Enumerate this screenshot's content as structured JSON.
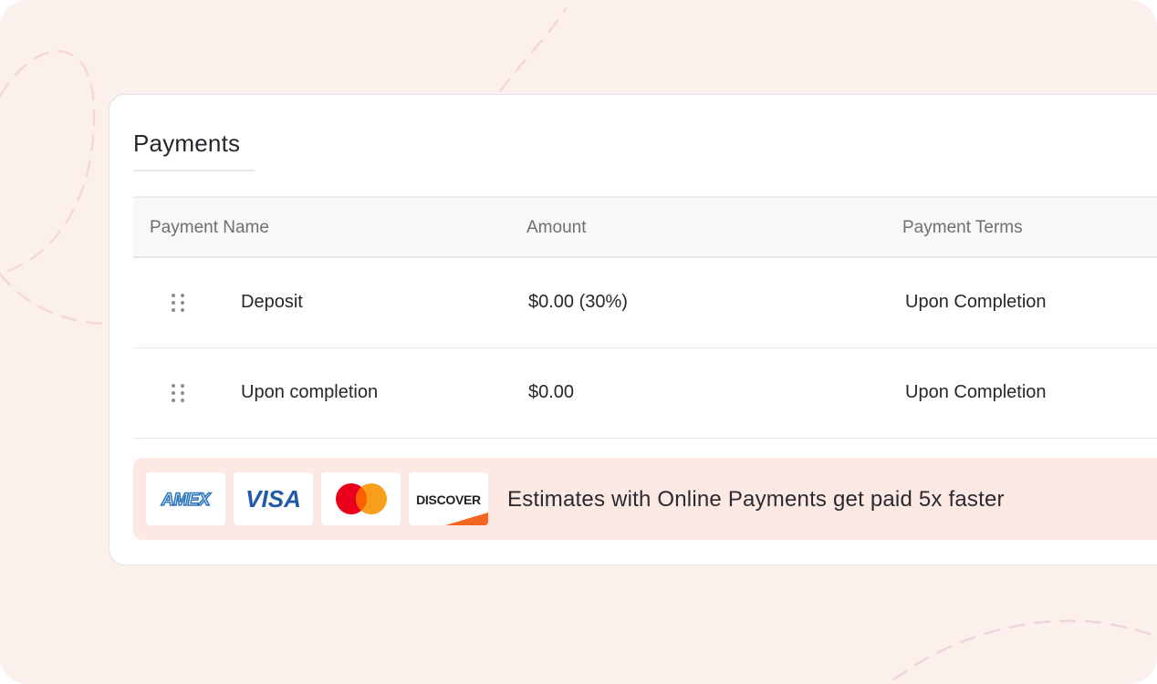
{
  "card": {
    "title": "Payments"
  },
  "table": {
    "headers": [
      "Payment Name",
      "Amount",
      "Payment Terms"
    ],
    "rows": [
      {
        "name": "Deposit",
        "amount": "$0.00 (30%)",
        "terms": "Upon Completion"
      },
      {
        "name": "Upon completion",
        "amount": "$0.00",
        "terms": "Upon Completion"
      }
    ]
  },
  "promo": {
    "logos": {
      "amex": "AMEX",
      "visa": "VISA",
      "mastercard": "mastercard",
      "discover": "DISCOVER"
    },
    "message": "Estimates with Online Payments get paid 5x faster"
  },
  "colors": {
    "background": "#fcf0ed",
    "promo_background": "#fde9e3",
    "amex_blue": "#2e77bc",
    "visa_blue": "#1f59a8",
    "mastercard_red": "#eb001b",
    "mastercard_orange": "#f79e1b",
    "discover_orange": "#f26522"
  },
  "icons": [
    "drag-handle-icon",
    "amex-logo",
    "visa-logo",
    "mastercard-logo",
    "discover-logo"
  ]
}
